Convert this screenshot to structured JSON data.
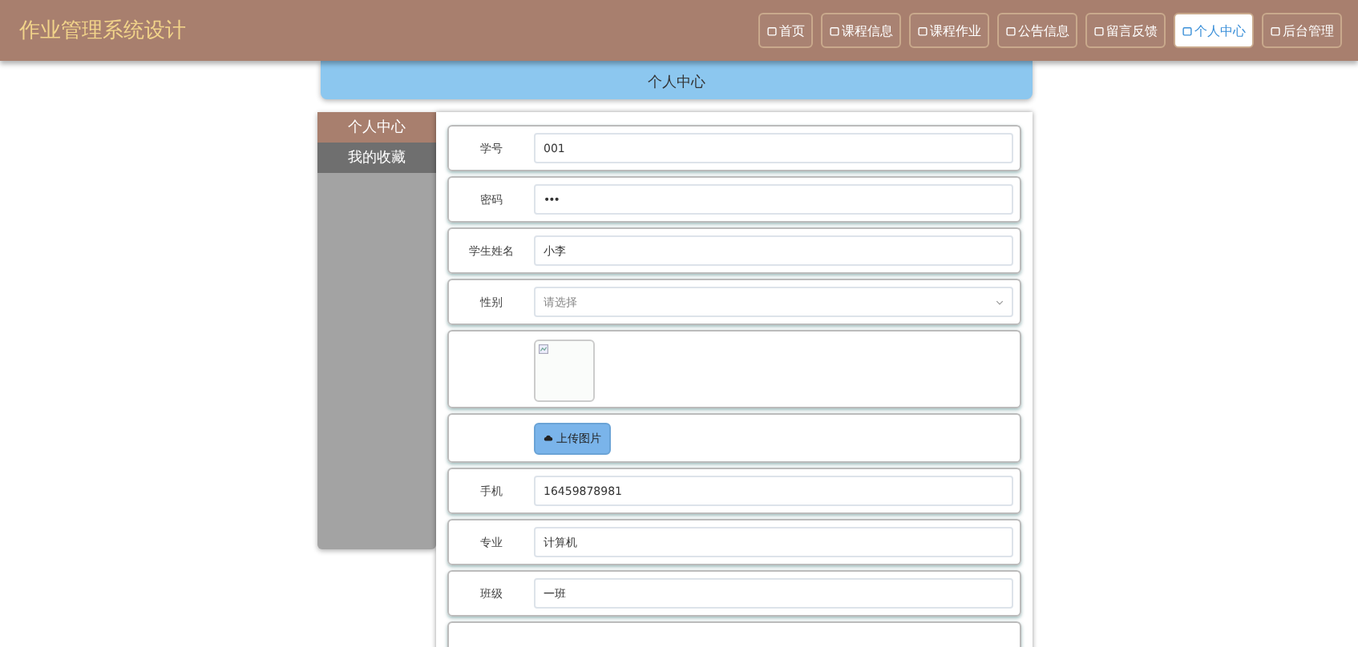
{
  "header": {
    "title": "作业管理系统设计",
    "nav": [
      {
        "label": "首页",
        "selected": false
      },
      {
        "label": "课程信息",
        "selected": false
      },
      {
        "label": "课程作业",
        "selected": false
      },
      {
        "label": "公告信息",
        "selected": false
      },
      {
        "label": "留言反馈",
        "selected": false
      },
      {
        "label": "个人中心",
        "selected": true
      },
      {
        "label": "后台管理",
        "selected": false
      }
    ]
  },
  "banner": {
    "title": "个人中心"
  },
  "sidebar": {
    "items": [
      {
        "label": "个人中心",
        "selected": true
      },
      {
        "label": "我的收藏",
        "selected": false
      }
    ]
  },
  "form": {
    "rows": [
      {
        "kind": "text",
        "label": "学号",
        "value": "001"
      },
      {
        "kind": "password",
        "label": "密码",
        "value": "•••"
      },
      {
        "kind": "text",
        "label": "学生姓名",
        "value": "小李"
      },
      {
        "kind": "select",
        "label": "性别",
        "placeholder": "请选择"
      },
      {
        "kind": "image"
      },
      {
        "kind": "upload",
        "button": "上传图片"
      },
      {
        "kind": "text",
        "label": "手机",
        "value": "16459878981"
      },
      {
        "kind": "text",
        "label": "专业",
        "value": "计算机"
      },
      {
        "kind": "text",
        "label": "班级",
        "value": "一班"
      },
      {
        "kind": "cut"
      }
    ]
  }
}
